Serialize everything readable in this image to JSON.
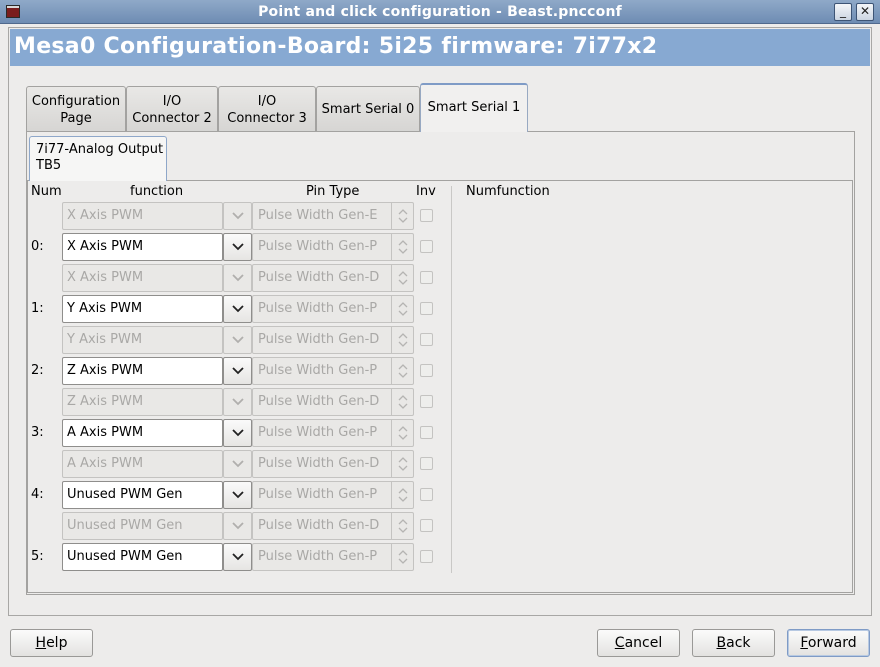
{
  "window": {
    "title": "Point and click configuration - Beast.pncconf",
    "minimize_symbol": "_",
    "close_symbol": "✕"
  },
  "header": {
    "title": "Mesa0 Configuration-Board: 5i25 firmware: 7i77x2"
  },
  "tabs": [
    {
      "line1": "Configuration",
      "line2": "Page"
    },
    {
      "line1": "I/O",
      "line2": "Connector 2"
    },
    {
      "line1": "I/O",
      "line2": "Connector 3"
    },
    {
      "line1": "Smart Serial 0",
      "line2": ""
    },
    {
      "line1": "Smart Serial 1",
      "line2": ""
    }
  ],
  "active_tab": "Smart Serial 1",
  "sub_tab": {
    "line1": "7i77-Analog Output",
    "line2": "TB5"
  },
  "columns": {
    "num": "Num",
    "function": "function",
    "pin_type": "Pin Type",
    "inv": "Inv",
    "numfunction": "Numfunction"
  },
  "rows": [
    {
      "num": "",
      "function": "X Axis PWM",
      "pin_type": "Pulse Width Gen-E",
      "enabled": false,
      "inv": false
    },
    {
      "num": "0:",
      "function": "X Axis PWM",
      "pin_type": "Pulse Width Gen-P",
      "enabled": true,
      "inv": false
    },
    {
      "num": "",
      "function": "X Axis PWM",
      "pin_type": "Pulse Width Gen-D",
      "enabled": false,
      "inv": false
    },
    {
      "num": "1:",
      "function": "Y Axis PWM",
      "pin_type": "Pulse Width Gen-P",
      "enabled": true,
      "inv": false
    },
    {
      "num": "",
      "function": "Y Axis PWM",
      "pin_type": "Pulse Width Gen-D",
      "enabled": false,
      "inv": false
    },
    {
      "num": "2:",
      "function": "Z Axis PWM",
      "pin_type": "Pulse Width Gen-P",
      "enabled": true,
      "inv": false
    },
    {
      "num": "",
      "function": "Z Axis PWM",
      "pin_type": "Pulse Width Gen-D",
      "enabled": false,
      "inv": false
    },
    {
      "num": "3:",
      "function": "A Axis PWM",
      "pin_type": "Pulse Width Gen-P",
      "enabled": true,
      "inv": false
    },
    {
      "num": "",
      "function": "A Axis PWM",
      "pin_type": "Pulse Width Gen-D",
      "enabled": false,
      "inv": false
    },
    {
      "num": "4:",
      "function": "Unused PWM Gen",
      "pin_type": "Pulse Width Gen-P",
      "enabled": true,
      "inv": false
    },
    {
      "num": "",
      "function": "Unused PWM Gen",
      "pin_type": "Pulse Width Gen-D",
      "enabled": false,
      "inv": false
    },
    {
      "num": "5:",
      "function": "Unused PWM Gen",
      "pin_type": "Pulse Width Gen-P",
      "enabled": true,
      "inv": false
    }
  ],
  "buttons": {
    "help_accel": "H",
    "help_rest": "elp",
    "cancel_accel": "C",
    "cancel_rest": "ancel",
    "back_accel": "B",
    "back_rest": "ack",
    "forward_accel": "F",
    "forward_rest": "orward"
  },
  "colors": {
    "header_bg": "#87a9d2",
    "titlebar": "#7d99be",
    "active_tab_accent": "#7f9bc6"
  }
}
